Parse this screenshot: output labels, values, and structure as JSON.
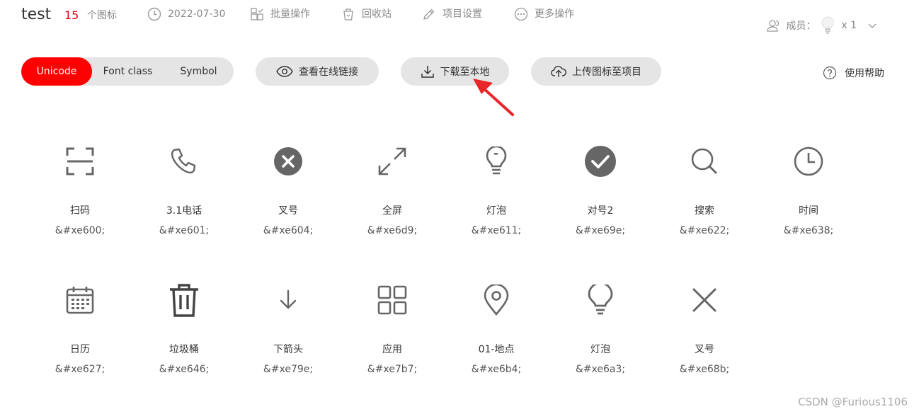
{
  "header": {
    "project_name": "test",
    "icon_count": "15",
    "icon_count_label": "个图标",
    "date": "2022-07-30",
    "batch_ops": "批量操作",
    "recycle_bin": "回收站",
    "project_settings": "项目设置",
    "more_ops": "更多操作",
    "members_label": "成员：",
    "members_count": "x 1"
  },
  "tabs": [
    {
      "label": "Unicode",
      "active": true
    },
    {
      "label": "Font class",
      "active": false
    },
    {
      "label": "Symbol",
      "active": false
    }
  ],
  "actions": {
    "view_online_link": "查看在线链接",
    "download_local": "下载至本地",
    "upload_icons": "上传图标至项目",
    "help": "使用帮助"
  },
  "icons": [
    {
      "name": "扫码",
      "code": "&#xe600;",
      "icon": "scan-icon"
    },
    {
      "name": "3.1电话",
      "code": "&#xe601;",
      "icon": "phone-icon"
    },
    {
      "name": "叉号",
      "code": "&#xe604;",
      "icon": "close-circle-icon"
    },
    {
      "name": "全屏",
      "code": "&#xe6d9;",
      "icon": "fullscreen-icon"
    },
    {
      "name": "灯泡",
      "code": "&#xe611;",
      "icon": "lightbulb-icon"
    },
    {
      "name": "对号2",
      "code": "&#xe69e;",
      "icon": "check-circle-icon"
    },
    {
      "name": "搜索",
      "code": "&#xe622;",
      "icon": "search-icon"
    },
    {
      "name": "时间",
      "code": "&#xe638;",
      "icon": "clock-icon"
    },
    {
      "name": "日历",
      "code": "&#xe627;",
      "icon": "calendar-icon"
    },
    {
      "name": "垃圾桶",
      "code": "&#xe646;",
      "icon": "trash-icon"
    },
    {
      "name": "下箭头",
      "code": "&#xe79e;",
      "icon": "arrow-down-icon"
    },
    {
      "name": "应用",
      "code": "&#xe7b7;",
      "icon": "apps-grid-icon"
    },
    {
      "name": "01-地点",
      "code": "&#xe6b4;",
      "icon": "location-pin-icon"
    },
    {
      "name": "灯泡",
      "code": "&#xe6a3;",
      "icon": "lightbulb-outline-icon"
    },
    {
      "name": "叉号",
      "code": "&#xe68b;",
      "icon": "close-icon"
    }
  ],
  "watermark": "CSDN @Furious1106",
  "colors": {
    "accent": "#ff0000",
    "icon": "#666666",
    "pill_bg": "#e5e5e5",
    "annotation_arrow": "#e8262a"
  }
}
